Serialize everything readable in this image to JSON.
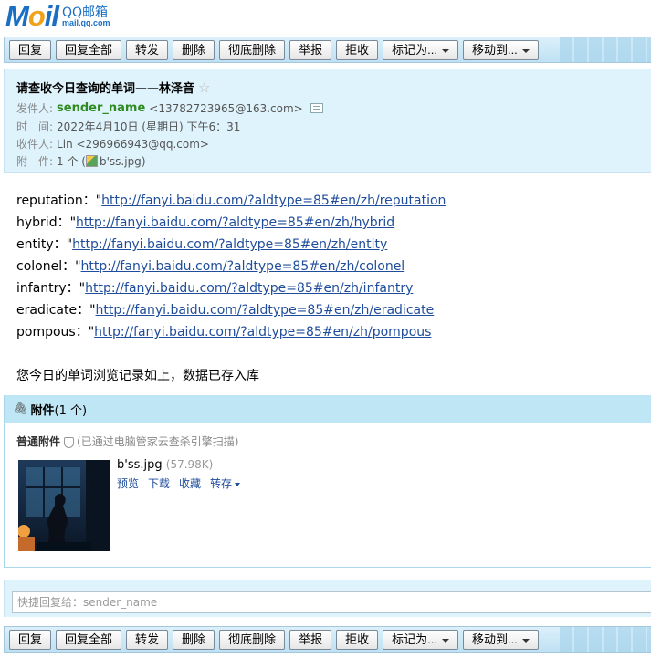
{
  "logo": {
    "brand": "Mail",
    "product": "QQ邮箱",
    "url": "mail.qq.com"
  },
  "toolbar": {
    "reply": "回复",
    "reply_all": "回复全部",
    "forward": "转发",
    "delete": "删除",
    "perm_delete": "彻底删除",
    "report": "举报",
    "reject": "拒收",
    "mark_as": "标记为...",
    "move_to": "移动到..."
  },
  "header": {
    "subject": "请查收今日查询的单词——林泽音",
    "from_label": "发件人:",
    "from_name": "sender_name",
    "from_addr": "<13782723965@163.com>",
    "time_label": "时　间:",
    "time": "2022年4月10日 (星期日) 下午6：31",
    "to_label": "收件人:",
    "to": "Lin <296966943@qq.com>",
    "att_label": "附　件:",
    "att_count": "1 个 (",
    "att_file": "b'ss.jpg",
    "att_close": ")"
  },
  "body": {
    "words": [
      {
        "word": "reputation：\"",
        "link": "http://fanyi.baidu.com/?aldtype=85#en/zh/reputation"
      },
      {
        "word": "hybrid：\"",
        "link": "http://fanyi.baidu.com/?aldtype=85#en/zh/hybrid"
      },
      {
        "word": "entity：\"",
        "link": "http://fanyi.baidu.com/?aldtype=85#en/zh/entity"
      },
      {
        "word": "colonel：\"",
        "link": "http://fanyi.baidu.com/?aldtype=85#en/zh/colonel"
      },
      {
        "word": "infantry：\"",
        "link": "http://fanyi.baidu.com/?aldtype=85#en/zh/infantry"
      },
      {
        "word": "eradicate：\"",
        "link": "http://fanyi.baidu.com/?aldtype=85#en/zh/eradicate"
      },
      {
        "word": "pompous：\"",
        "link": "http://fanyi.baidu.com/?aldtype=85#en/zh/pompous"
      }
    ],
    "note": "您今日的单词浏览记录如上，数据已存入库"
  },
  "attachments": {
    "title": "附件",
    "count": "(1 个)",
    "section": "普通附件",
    "scan": "(已通过电脑管家云查杀引擎扫描)",
    "file_name": "b'ss.jpg",
    "file_size": "(57.98K)",
    "preview": "预览",
    "download": "下载",
    "favorite": "收藏",
    "save_to": "转存"
  },
  "quick_reply": {
    "placeholder": "快捷回复给：sender_name"
  }
}
